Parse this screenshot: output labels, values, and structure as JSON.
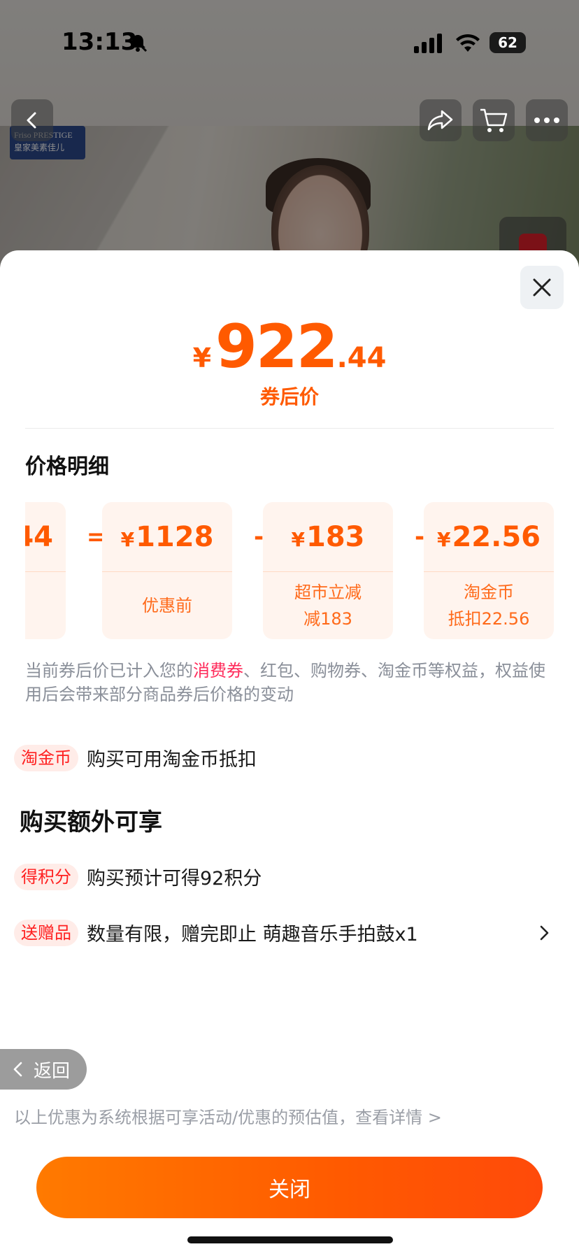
{
  "status_bar": {
    "time": "13:13",
    "battery": "62"
  },
  "background": {
    "brand_line1": "Friso PRESTIGE",
    "brand_line2": "皇家美素佳儿"
  },
  "price": {
    "currency": "¥",
    "integer": "922",
    "decimal": ".44",
    "label": "券后价"
  },
  "details": {
    "title": "价格明细",
    "partial_card_value": "44",
    "equals": "=",
    "minus": "-",
    "cards": [
      {
        "currency": "¥",
        "value": "1128",
        "label": "优惠前"
      },
      {
        "currency": "¥",
        "value": "183",
        "label": "超市立减\n减183"
      },
      {
        "currency": "¥",
        "value": "22.56",
        "label": "淘金币\n抵扣22.56"
      }
    ]
  },
  "notice": {
    "prefix": "当前券后价已计入您的",
    "highlight": "消费券",
    "suffix": "、红包、购物券、淘金币等权益，权益使用后会带来部分商品券后价格的变动"
  },
  "benefits": [
    {
      "tag": "淘金币",
      "text": "购买可用淘金币抵扣"
    }
  ],
  "extra": {
    "title": "购买额外可享",
    "items": [
      {
        "tag": "得积分",
        "text": "购买预计可得92积分"
      },
      {
        "tag": "送赠品",
        "text": "数量有限，赠完即止 萌趣音乐手拍鼓x1"
      }
    ]
  },
  "back_label": "返回",
  "footnote": "以上优惠为系统根据可享活动/优惠的预估值，查看详情 >",
  "close_label": "关闭",
  "colors": {
    "accent": "#ff5a00",
    "tag_red": "#ff2020",
    "highlight_pink": "#ff2a5a"
  }
}
